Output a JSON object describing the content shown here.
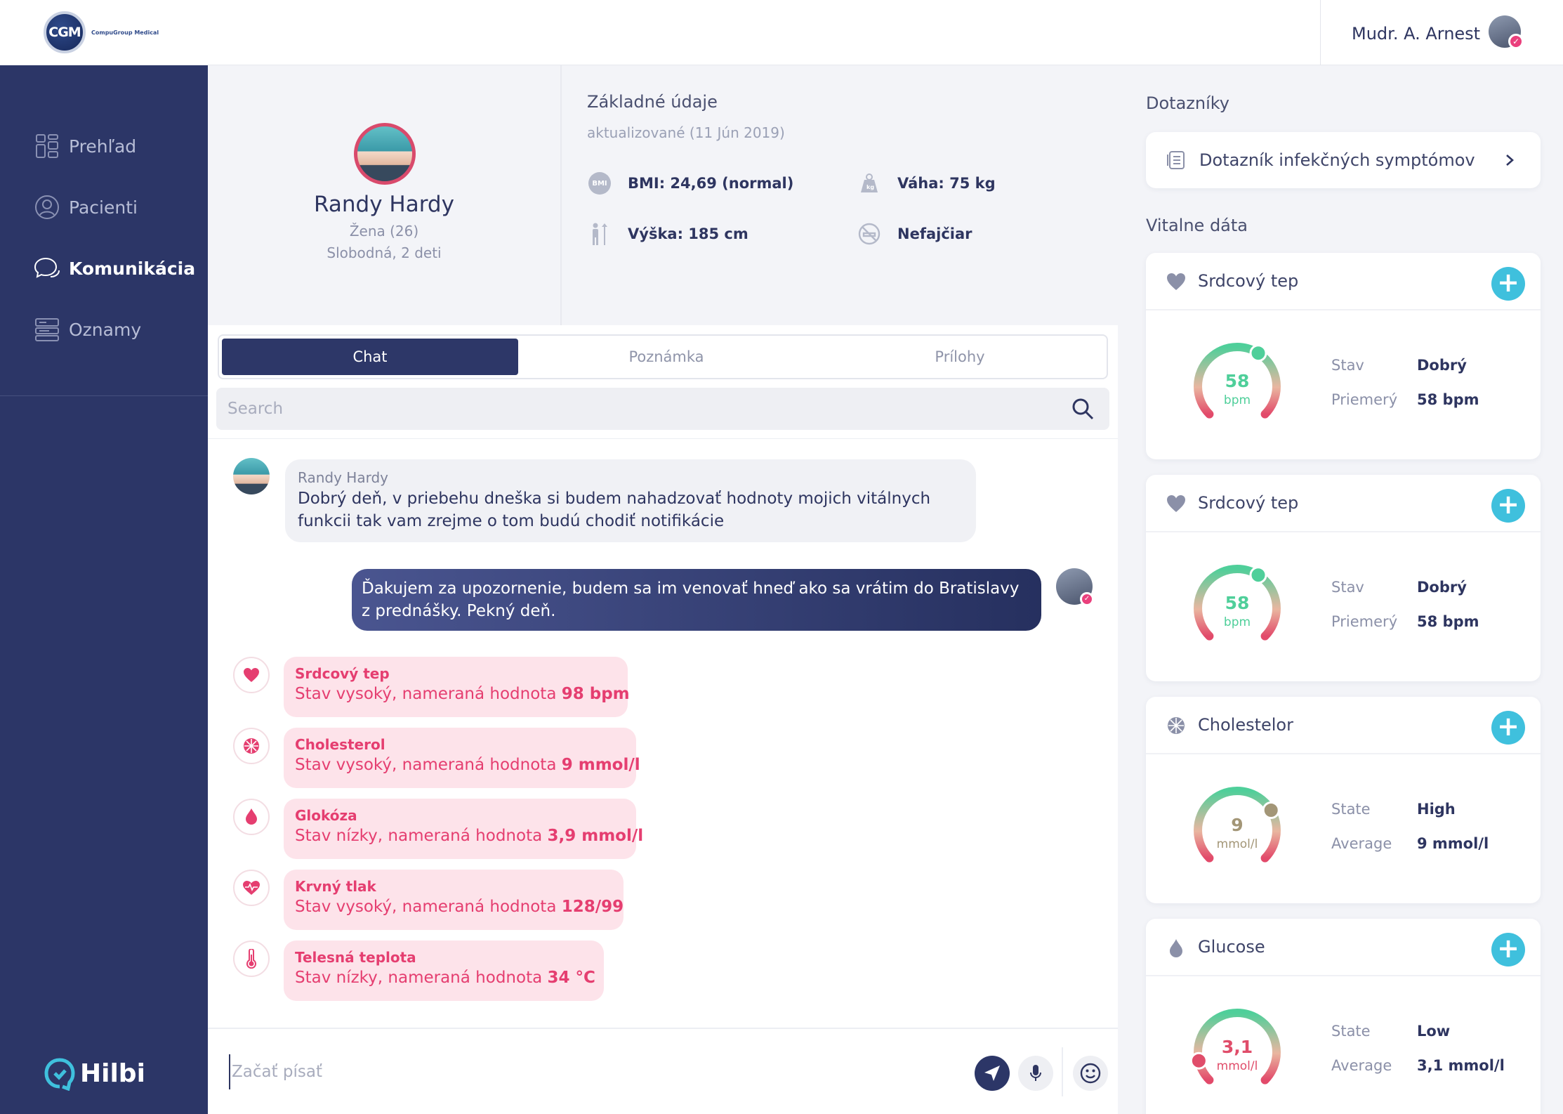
{
  "header": {
    "logo_text": "CGM",
    "logo_sub": "CompuGroup Medical",
    "user_name": "Mudr. A. Arnest"
  },
  "sidebar": {
    "items": [
      {
        "label": "Prehľad",
        "icon": "dashboard-icon"
      },
      {
        "label": "Pacienti",
        "icon": "patients-icon"
      },
      {
        "label": "Komunikácia",
        "icon": "chat-bubbles-icon",
        "active": true
      },
      {
        "label": "Oznamy",
        "icon": "announcements-icon"
      }
    ],
    "brand": "Hilbi"
  },
  "patient": {
    "name": "Randy Hardy",
    "gender_age": "Žena (26)",
    "status": "Slobodná, 2 deti"
  },
  "basic_data": {
    "title": "Základné údaje",
    "updated": "aktualizované (11 Jún 2019)",
    "bmi_badge": "BMI",
    "bmi": "BMI: 24,69 (normal)",
    "weight": "Váha: 75 kg",
    "height": "Výška: 185 cm",
    "smoker": "Nefajčiar"
  },
  "tabs": [
    {
      "label": "Chat",
      "active": true
    },
    {
      "label": "Poznámka"
    },
    {
      "label": "Prílohy"
    }
  ],
  "search": {
    "placeholder": "Search"
  },
  "messages": {
    "incoming": {
      "author": "Randy Hardy",
      "text": "Dobrý deň, v priebehu dneška si budem nahadzovať hodnoty mojich vitálnych funkcii tak vam zrejme o tom budú chodiť notifikácie"
    },
    "outgoing": {
      "text": "Ďakujem za upozornenie, budem sa im venovať hneď ako sa vrátim do Bratislavy z prednášky. Pekný deň."
    }
  },
  "alerts": [
    {
      "title": "Srdcový tep",
      "text": "Stav vysoký, nameraná hodnota",
      "value": "98 bpm",
      "icon": "heart-icon"
    },
    {
      "title": "Cholesterol",
      "text": "Stav vysoký, nameraná hodnota",
      "value": "9 mmol/l",
      "icon": "cholesterol-icon"
    },
    {
      "title": "Glokóza",
      "text": "Stav nízky, nameraná hodnota",
      "value": "3,9 mmol/l",
      "icon": "drop-icon"
    },
    {
      "title": "Krvný tlak",
      "text": "Stav vysoký, nameraná hodnota",
      "value": "128/99",
      "icon": "blood-pressure-icon"
    },
    {
      "title": "Telesná teplota",
      "text": "Stav nízky, nameraná hodnota",
      "value": "34 °C",
      "icon": "thermometer-icon"
    }
  ],
  "composer": {
    "placeholder": "Začať písať"
  },
  "right_panel": {
    "questionnaires_title": "Dotazníky",
    "questionnaire": "Dotazník infekčných symptómov",
    "vitals_title": "Vitalne dáta",
    "vitals": [
      {
        "title": "Srdcový tep",
        "icon": "heart-icon",
        "value": "58",
        "unit": "bpm",
        "label1": "Stav",
        "val1": "Dobrý",
        "label2": "Priemerý",
        "val2": "58 bpm",
        "color": "#4fcf9a",
        "level": 0.62
      },
      {
        "title": "Srdcový tep",
        "icon": "heart-icon",
        "value": "58",
        "unit": "bpm",
        "label1": "Stav",
        "val1": "Dobrý",
        "label2": "Priemerý",
        "val2": "58 bpm",
        "color": "#4fcf9a",
        "level": 0.62
      },
      {
        "title": "Cholestelor",
        "icon": "cholesterol-icon",
        "value": "9",
        "unit": "mmol/l",
        "label1": "State",
        "val1": "High",
        "label2": "Average",
        "val2": "9 mmol/l",
        "color": "#a39677",
        "level": 0.72
      },
      {
        "title": "Glucose",
        "icon": "drop-icon",
        "value": "3,1",
        "unit": "mmol/l",
        "label1": "State",
        "val1": "Low",
        "label2": "Average",
        "val2": "3,1 mmol/l",
        "color": "#e04d6a",
        "level": 0.12
      }
    ]
  },
  "colors": {
    "sidebar": "#2c3667",
    "accent_pink": "#e53e70",
    "accent_cyan": "#3fc0dd",
    "good_green": "#4fcf9a"
  }
}
